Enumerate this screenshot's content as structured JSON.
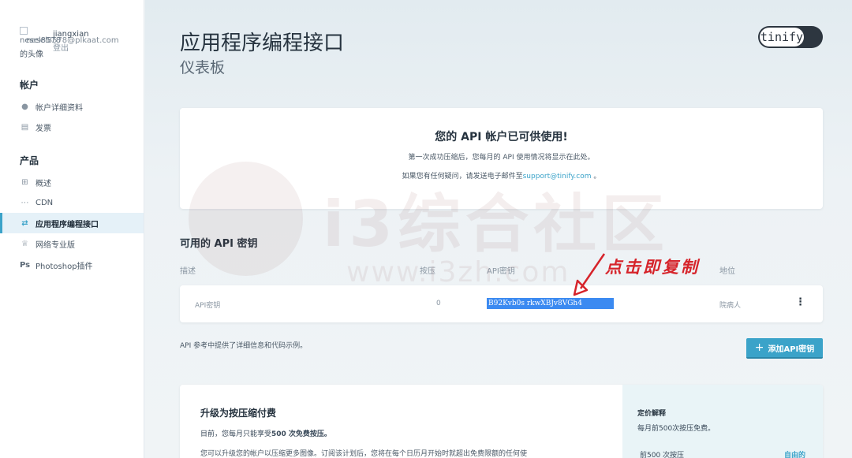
{
  "sidebar": {
    "avatar_alt_top": "nesel8578",
    "avatar_alt_bottom": "的头像",
    "user_name": "jiangxian",
    "user_email": "nesel8578@plkaat.com",
    "logout": "登出",
    "section_account": "帐户",
    "item_account_details": "帐户详细资料",
    "item_invoice": "发票",
    "section_products": "产品",
    "item_overview": "概述",
    "item_cdn": "CDN",
    "item_api": "应用程序编程接口",
    "item_web_pro": "网络专业版",
    "item_photoshop": "Photoshop插件"
  },
  "header": {
    "title": "应用程序编程接口",
    "subtitle": "仪表板",
    "brand": "tinify"
  },
  "ready_card": {
    "title": "您的 API 帐户已可供使用!",
    "line1": "第一次成功压缩后，您每月的 API 使用情况将显示在此处。",
    "line2_prefix": "如果您有任何疑问，请发送电子邮件至",
    "line2_email": "support@tinify.com",
    "line2_suffix": " 。"
  },
  "keys_section": {
    "title": "可用的 API 密钥",
    "col_description": "描述",
    "col_compressions": "按压",
    "col_key": "API密钥",
    "col_status": "地位",
    "row": {
      "description": "API密钥",
      "compressions": "0",
      "key": "B92Kvb0s                         rkwXBJv8VGh4",
      "status": "院病人"
    },
    "api_reference": "API 参考中提供了详细信息和代码示例。",
    "add_button": "添加API密钥"
  },
  "upgrade": {
    "title": "升级为按压缩付费",
    "line1_prefix": "目前，您每月只能享受",
    "line1_bold": "500 次免费按压。",
    "line2": "您可以升级您的帐户以压缩更多图像。订阅该计划后，您将在每个日历月开始时就超出免费限额的任何使",
    "pricing_title": "定价解释",
    "pricing_line": "每月前500次按压免费。",
    "pricing_row_label": "前500 次按压",
    "pricing_row_value": "自由的"
  },
  "overlay": {
    "annotation": "点击即复制",
    "watermark_text": "i3综合社区",
    "watermark_url": "www.i3zh.com"
  },
  "colors": {
    "accent": "#3ba3c9",
    "selection": "#3b8af1",
    "annotation": "#d6232a"
  }
}
